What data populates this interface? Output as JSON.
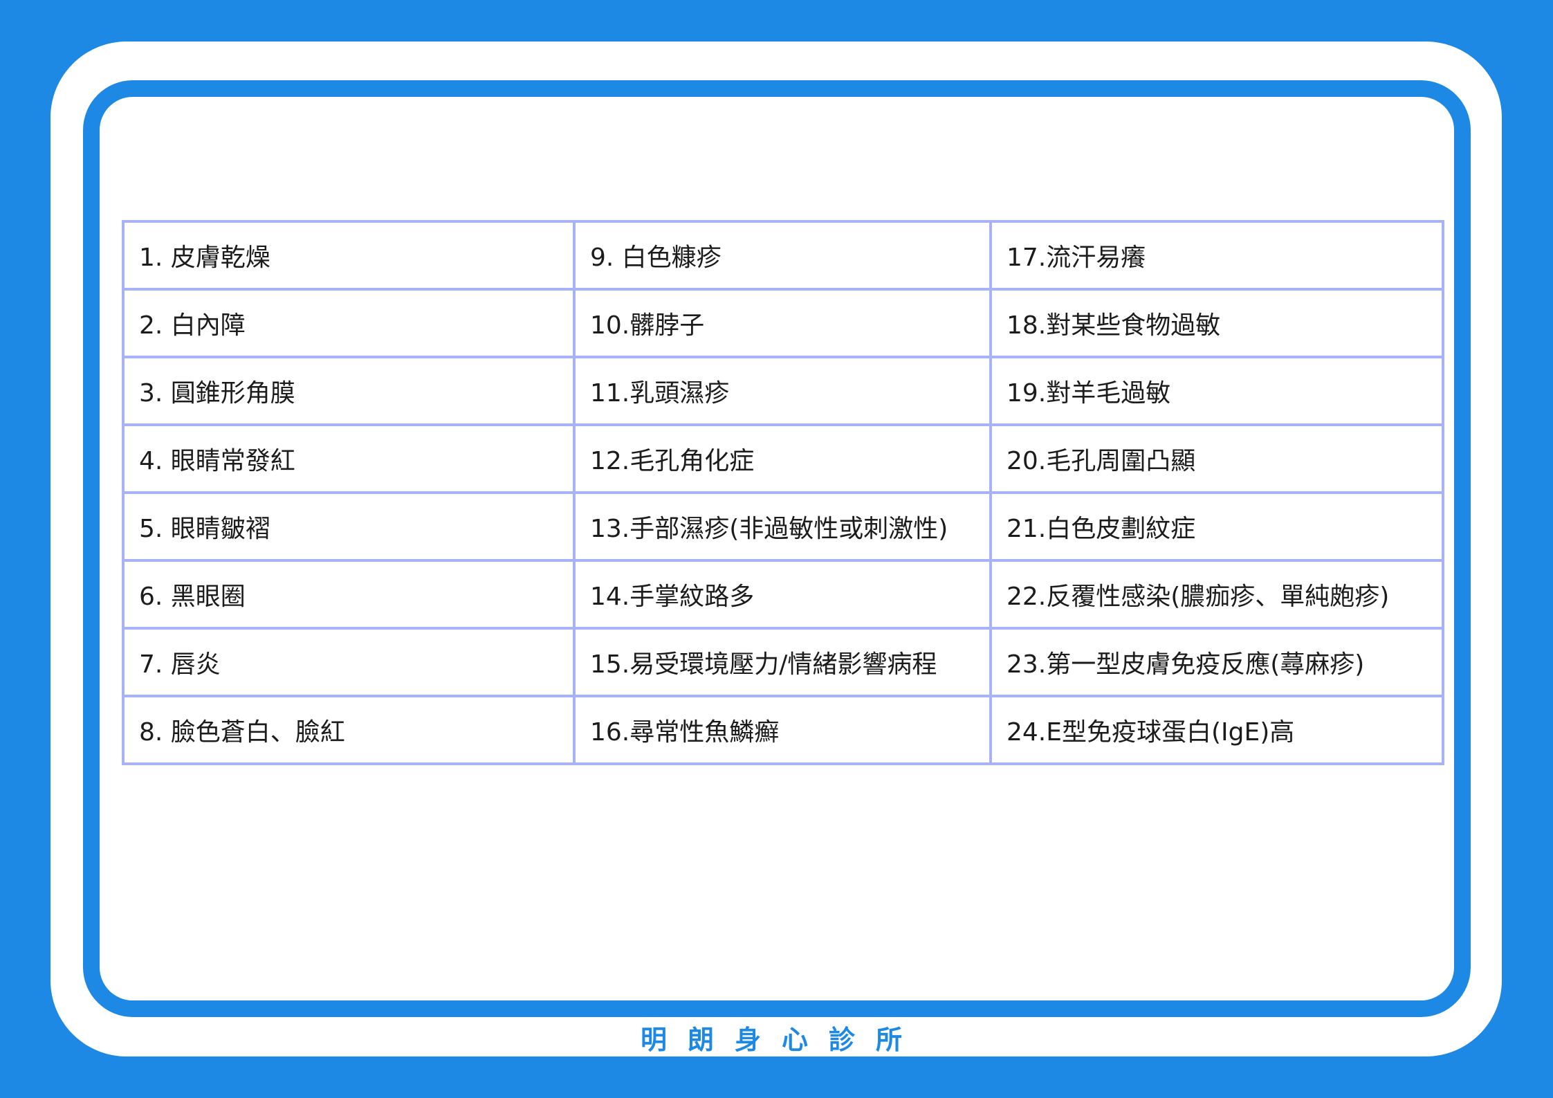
{
  "colors": {
    "background": "#1e88e5",
    "card": "#ffffff",
    "table_border": "#a7b2f7",
    "footer_text": "#1e88e5"
  },
  "table": {
    "rows": [
      [
        "1. 皮膚乾燥",
        "9.  白色糠疹",
        "17.流汗易癢"
      ],
      [
        "2. 白內障",
        "10.髒脖子",
        "18.對某些食物過敏"
      ],
      [
        "3. 圓錐形角膜",
        "11.乳頭濕疹",
        "19.對羊毛過敏"
      ],
      [
        "4. 眼睛常發紅",
        "12.毛孔角化症",
        "20.毛孔周圍凸顯"
      ],
      [
        "5. 眼睛皺褶",
        "13.手部濕疹(非過敏性或刺激性)",
        "21.白色皮劃紋症"
      ],
      [
        "6. 黑眼圈",
        "14.手掌紋路多",
        "22.反覆性感染(膿痂疹、單純皰疹)"
      ],
      [
        "7.  唇炎",
        "15.易受環境壓力/情緒影響病程",
        "23.第一型皮膚免疫反應(蕁麻疹)"
      ],
      [
        "8.  臉色蒼白、臉紅",
        "16.尋常性魚鱗癬",
        "24.E型免疫球蛋白(IgE)高"
      ]
    ]
  },
  "footer": {
    "clinic_name": "明朗身心診所"
  }
}
